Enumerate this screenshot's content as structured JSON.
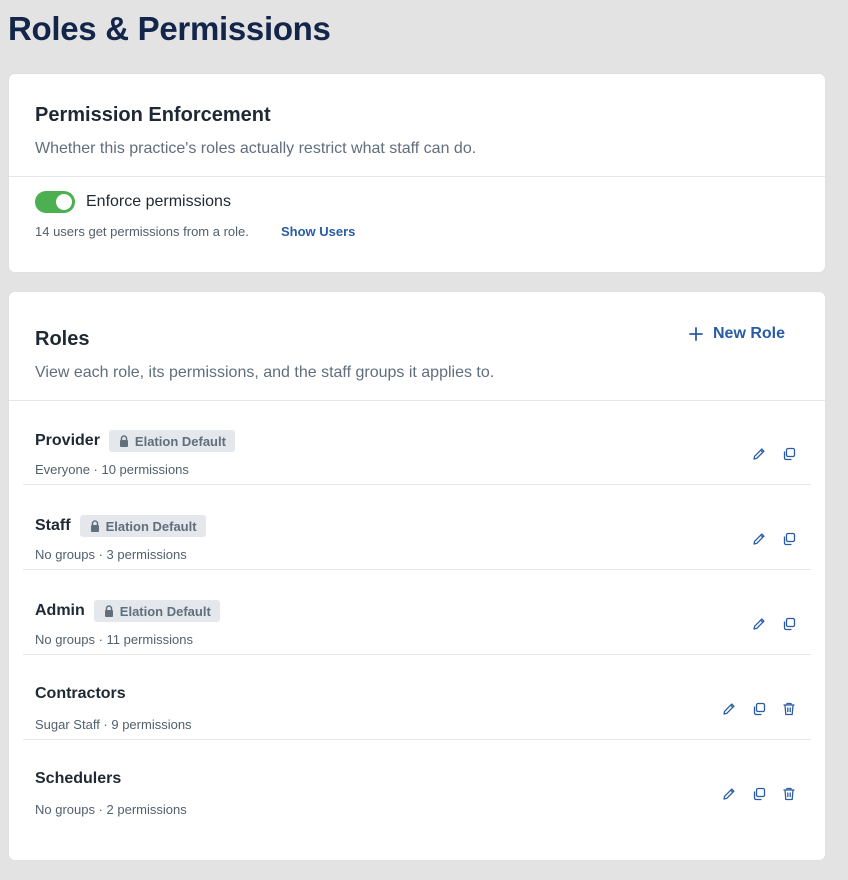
{
  "page": {
    "title": "Roles & Permissions"
  },
  "enforcement": {
    "heading": "Permission Enforcement",
    "subtitle": "Whether this practice's roles actually restrict what staff can do.",
    "toggle_label": "Enforce permissions",
    "toggle_on": true,
    "users_note": "14 users get permissions from a role.",
    "show_users_label": "Show Users"
  },
  "roles": {
    "heading": "Roles",
    "subtitle": "View each role, its permissions, and the staff groups it applies to.",
    "new_role_label": "New Role",
    "items": [
      {
        "name": "Provider",
        "badge": "Elation Default",
        "meta": "Everyone · 10 permissions",
        "deletable": false
      },
      {
        "name": "Staff",
        "badge": "Elation Default",
        "meta": "No groups · 3 permissions",
        "deletable": false
      },
      {
        "name": "Admin",
        "badge": "Elation Default",
        "meta": "No groups · 11 permissions",
        "deletable": false
      },
      {
        "name": "Contractors",
        "badge": "",
        "meta": "Sugar Staff · 9 permissions",
        "deletable": true
      },
      {
        "name": "Schedulers",
        "badge": "",
        "meta": "No groups · 2 permissions",
        "deletable": true
      }
    ]
  },
  "colors": {
    "accent": "#2a5ca6",
    "title": "#14254a",
    "toggle_on": "#4caf50",
    "page_bg": "#e3e3e3",
    "badge_bg": "#e4e7eb"
  }
}
